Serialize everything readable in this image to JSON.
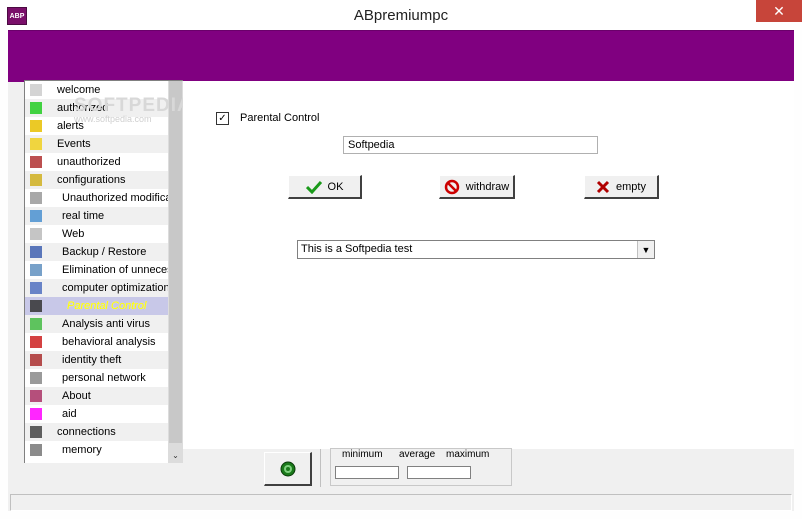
{
  "window": {
    "title": "ABpremiumpc",
    "app_icon_text": "ABP",
    "close_glyph": "✕"
  },
  "watermark": {
    "text": "SOFTPEDIA",
    "url": "www.softpedia.com"
  },
  "colors": {
    "banner": "#800080",
    "selected_text": "#ffff00"
  },
  "nav": {
    "items": [
      {
        "label": "welcome",
        "icon": "welcome-icon"
      },
      {
        "label": "authorized",
        "icon": "green-square-icon"
      },
      {
        "label": "alerts",
        "icon": "warning-icon"
      },
      {
        "label": "Events",
        "icon": "lightbulb-icon"
      },
      {
        "label": "unauthorized",
        "icon": "block-icon"
      },
      {
        "label": "configurations",
        "icon": "config-icon"
      },
      {
        "label": "Unauthorized modifications",
        "icon": "check-icon"
      },
      {
        "label": "real time",
        "icon": "realtime-icon"
      },
      {
        "label": "Web",
        "icon": "web-icon"
      },
      {
        "label": "Backup / Restore",
        "icon": "backup-icon"
      },
      {
        "label": "Elimination of unnecessary",
        "icon": "eliminate-icon"
      },
      {
        "label": "computer optimization",
        "icon": "optimize-icon"
      },
      {
        "label": "Parental Control",
        "icon": "parental-icon"
      },
      {
        "label": "Analysis anti virus",
        "icon": "antivirus-icon"
      },
      {
        "label": "behavioral analysis",
        "icon": "checkmark-icon"
      },
      {
        "label": "identity theft",
        "icon": "identity-icon"
      },
      {
        "label": "personal network",
        "icon": "network-icon"
      },
      {
        "label": "About",
        "icon": "about-icon"
      },
      {
        "label": "aid",
        "icon": "aid-icon"
      },
      {
        "label": "connections",
        "icon": "connections-icon"
      },
      {
        "label": "memory",
        "icon": "memory-icon"
      }
    ],
    "selected": "Parental Control"
  },
  "parental": {
    "checkbox_label": "Parental Control",
    "checked": true,
    "name_value": "Softpedia",
    "ok_label": "OK",
    "withdraw_label": "withdraw",
    "empty_label": "empty",
    "combo_value": "This is a Softpedia test"
  },
  "bottom": {
    "minimum_label": "minimum",
    "average_label": "average",
    "maximum_label": "maximum"
  }
}
